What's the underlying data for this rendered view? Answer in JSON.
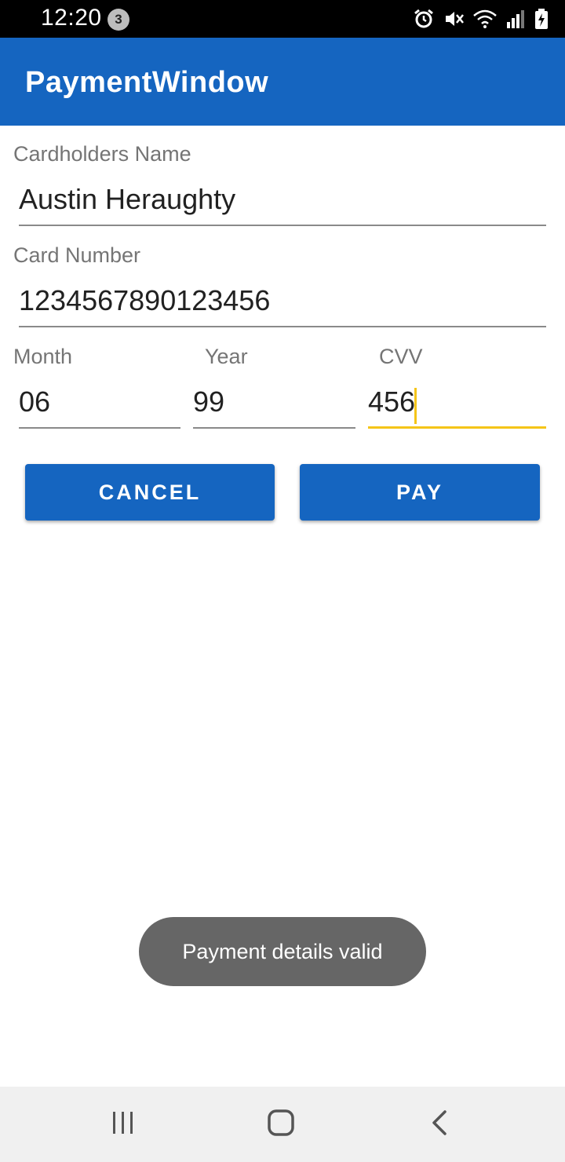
{
  "status_bar": {
    "time": "12:20",
    "notification_count": "3",
    "icons": [
      "alarm-icon",
      "mute-icon",
      "wifi-icon",
      "signal-icon",
      "battery-charging-icon"
    ]
  },
  "app_bar": {
    "title": "PaymentWindow",
    "color": "#1565c0"
  },
  "form": {
    "cardholder_label": "Cardholders Name",
    "cardholder_value": "Austin Heraughty",
    "card_number_label": "Card Number",
    "card_number_value": "1234567890123456",
    "month_label": "Month",
    "month_value": "06",
    "year_label": "Year",
    "year_value": "99",
    "cvv_label": "CVV",
    "cvv_value": "456"
  },
  "buttons": {
    "cancel_label": "CANCEL",
    "pay_label": "PAY"
  },
  "toast": {
    "message": "Payment details valid"
  },
  "nav_bar": {
    "icons": [
      "recent-apps-icon",
      "home-icon",
      "back-icon"
    ]
  },
  "colors": {
    "accent": "#1565c0",
    "focus_underline": "#f5c518",
    "toast_bg": "#666666"
  }
}
